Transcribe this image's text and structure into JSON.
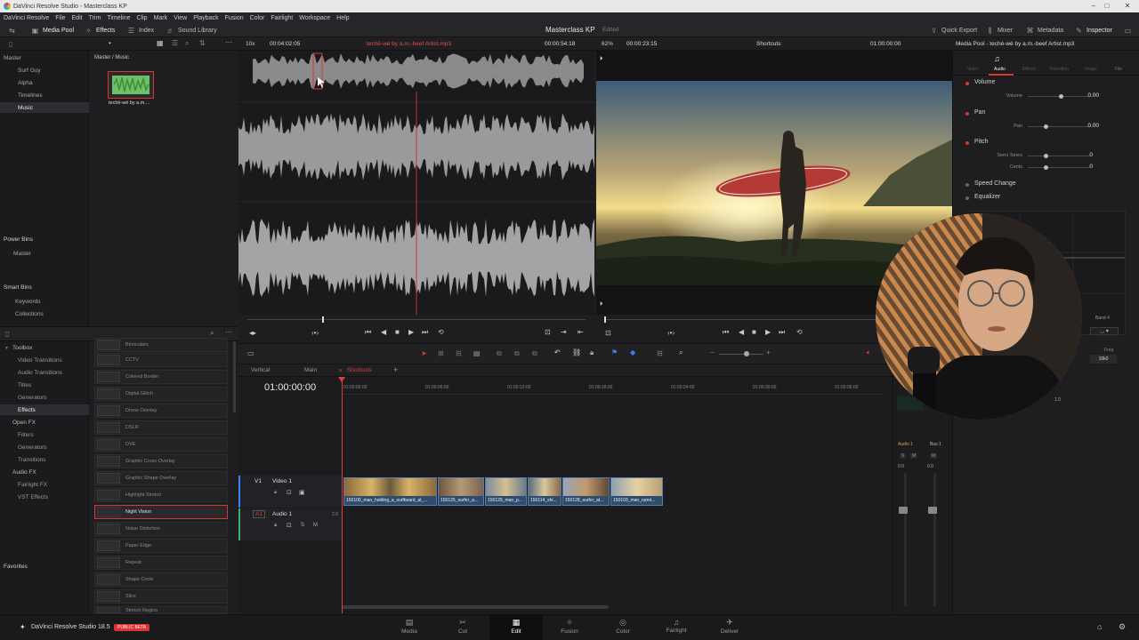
{
  "window": {
    "title": "DaVinci Resolve Studio - Masterclass KP"
  },
  "menu": [
    "DaVinci Resolve",
    "File",
    "Edit",
    "Trim",
    "Timeline",
    "Clip",
    "Mark",
    "View",
    "Playback",
    "Fusion",
    "Color",
    "Fairlight",
    "Workspace",
    "Help"
  ],
  "toolbar": {
    "media_pool": "Media Pool",
    "effects": "Effects",
    "index": "Index",
    "sound_library": "Sound Library",
    "project_title": "Masterclass KP",
    "project_status": "Edited",
    "quick_export": "Quick Export",
    "mixer": "Mixer",
    "metadata": "Metadata",
    "inspector": "Inspector"
  },
  "source": {
    "zoom": "10x",
    "timecode": "00:04:02:05",
    "clip_name": "teché-wé by a.m.-beef Artist.mp3",
    "duration": "00:00:54:18"
  },
  "viewer": {
    "zoom": "62%",
    "duration": "00:00:23:15",
    "timeline_name": "Shortcuts",
    "timecode": "01:00:00:00"
  },
  "inspector_panel": {
    "title": "Media Pool - teché-wé by a.m.-beef Artist.mp3",
    "tabs": [
      "Video",
      "Audio",
      "Effects",
      "Transition",
      "Image",
      "File"
    ],
    "active_tab": "Audio",
    "sections": {
      "volume": {
        "title": "Volume",
        "label": "Volume",
        "value": "0.00"
      },
      "pan": {
        "title": "Pan",
        "label": "Pan",
        "value": "0.00"
      },
      "pitch": {
        "title": "Pitch",
        "semitones_label": "Semi Tones",
        "semitones": "0",
        "cents_label": "Cents",
        "cents": "0"
      },
      "speed_change": "Speed Change",
      "equalizer": "Equalizer"
    },
    "eq": {
      "band": "Band 4",
      "freq_label": "Freq",
      "freq": "10k0",
      "gain": "1.0"
    }
  },
  "media_pool": {
    "breadcrumb": "Master / Music",
    "bins": {
      "root": "Master",
      "items": [
        "Surf Guy",
        "Alpha",
        "Timelines",
        "Music"
      ],
      "selected": "Music"
    },
    "clip_label": "teché-wé by a.m....",
    "power_bins_title": "Power Bins",
    "power_bins": [
      "Master"
    ],
    "smart_bins_title": "Smart Bins",
    "smart_bins": [
      "Keywords",
      "Collections"
    ],
    "favorites": "Favorites"
  },
  "effects_tree": {
    "items": [
      {
        "label": "Toolbox",
        "level": 0
      },
      {
        "label": "Video Transitions",
        "level": 1
      },
      {
        "label": "Audio Transitions",
        "level": 1
      },
      {
        "label": "Titles",
        "level": 1
      },
      {
        "label": "Generators",
        "level": 1
      },
      {
        "label": "Effects",
        "level": 1,
        "selected": true
      },
      {
        "label": "Open FX",
        "level": 0
      },
      {
        "label": "Filters",
        "level": 1
      },
      {
        "label": "Generators",
        "level": 1
      },
      {
        "label": "Transitions",
        "level": 1
      },
      {
        "label": "Audio FX",
        "level": 0
      },
      {
        "label": "Fairlight FX",
        "level": 1
      },
      {
        "label": "VST Effects",
        "level": 1
      }
    ],
    "list": [
      "Binoculars",
      "CCTV",
      "Colored Border",
      "Digital Glitch",
      "Drone Overlay",
      "DSLR",
      "DVE",
      "Graphic Cross Overlay",
      "Graphic Shape Overlay",
      "Highlight Stretch",
      "Night Vision",
      "Noise Distortion",
      "Paper Edge",
      "Repeat",
      "Shape Circle",
      "Slice",
      "Stretch Region"
    ],
    "selected": "Night Vision"
  },
  "timeline": {
    "tabs": [
      "Vertical",
      "Main",
      "Shortcuts"
    ],
    "active_tab": "Shortcuts",
    "timecode": "01:00:00:00",
    "ruler": [
      "01:00:00:00",
      "01:00:06:00",
      "01:00:12:00",
      "01:00:18:00",
      "01:00:24:00",
      "01:00:30:00",
      "01:00:36:00"
    ],
    "tracks": {
      "video": {
        "id": "V1",
        "name": "Video 1"
      },
      "audio": {
        "id": "A1",
        "name": "Audio 1",
        "channels": "2.0"
      }
    },
    "clips": [
      "150100_man_holding_a_surfboard_at_...",
      "150125_surfer_a...",
      "150129_man_p...",
      "150114_shi...",
      "150128_surfer_at...",
      "150103_man_runni..."
    ]
  },
  "mixer": {
    "audio1": "Audio 1",
    "bus1": "Bus 1",
    "val": "0.0"
  },
  "footer": {
    "app": "DaVinci Resolve Studio 18.5",
    "badge": "PUBLIC BETA",
    "pages": [
      "Media",
      "Cut",
      "Edit",
      "Fusion",
      "Color",
      "Fairlight",
      "Deliver"
    ],
    "active_page": "Edit"
  },
  "colors": {
    "accent_red": "#e03c3c",
    "clip_blue": "#3d5a7a",
    "ui_bg": "#1e1e20"
  }
}
